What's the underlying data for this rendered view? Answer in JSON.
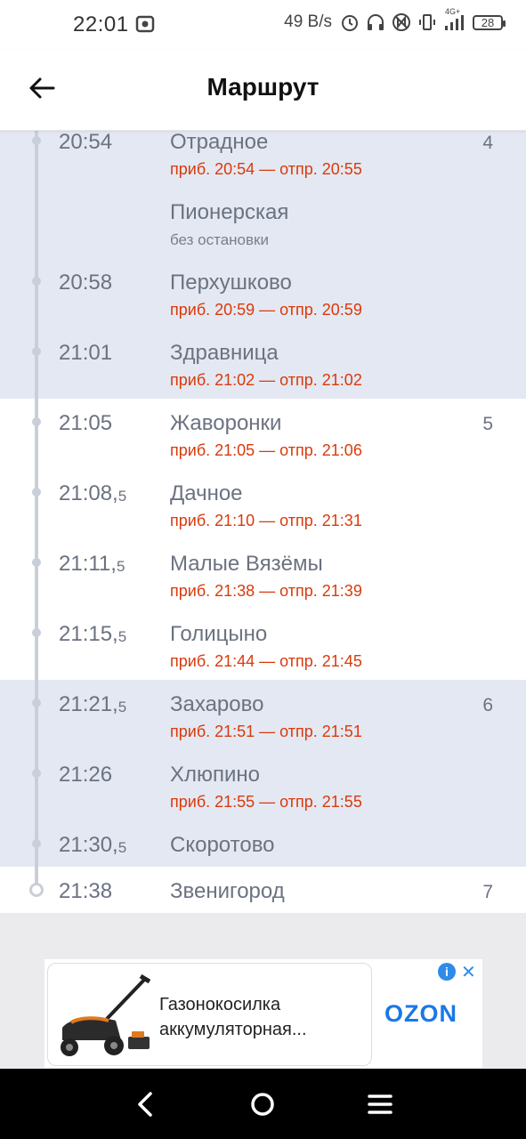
{
  "status_bar": {
    "time": "22:01",
    "speed": "49 B/s",
    "network": "4G+",
    "battery": "28",
    "icons": [
      "cast-icon",
      "alarm-icon",
      "headphones-icon",
      "nfc-icon",
      "vibrate-icon",
      "signal-icon",
      "battery-icon"
    ]
  },
  "header": {
    "title": "Маршрут",
    "back_icon": "back-arrow-icon"
  },
  "stops": [
    {
      "time": "20:54",
      "time_sub": "",
      "name": "Отрадное",
      "detail": "приб. 20:54 — отпр. 20:55",
      "detail_type": "red",
      "zone": "4"
    },
    {
      "time": "",
      "time_sub": "",
      "name": "Пионерская",
      "detail": "без остановки",
      "detail_type": "gray",
      "zone": ""
    },
    {
      "time": "20:58",
      "time_sub": "",
      "name": "Перхушково",
      "detail": "приб. 20:59 — отпр. 20:59",
      "detail_type": "red",
      "zone": ""
    },
    {
      "time": "21:01",
      "time_sub": "",
      "name": "Здравница",
      "detail": "приб. 21:02 — отпр. 21:02",
      "detail_type": "red",
      "zone": ""
    },
    {
      "time": "21:05",
      "time_sub": "",
      "name": "Жаворонки",
      "detail": "приб. 21:05 — отпр. 21:06",
      "detail_type": "red",
      "zone": "5"
    },
    {
      "time": "21:08,",
      "time_sub": "5",
      "name": "Дачное",
      "detail": "приб. 21:10 — отпр. 21:31",
      "detail_type": "red",
      "zone": ""
    },
    {
      "time": "21:11,",
      "time_sub": "5",
      "name": "Малые Вязёмы",
      "detail": "приб. 21:38 — отпр. 21:39",
      "detail_type": "red",
      "zone": ""
    },
    {
      "time": "21:15,",
      "time_sub": "5",
      "name": "Голицыно",
      "detail": "приб. 21:44 — отпр. 21:45",
      "detail_type": "red",
      "zone": ""
    },
    {
      "time": "21:21,",
      "time_sub": "5",
      "name": "Захарово",
      "detail": "приб. 21:51 — отпр. 21:51",
      "detail_type": "red",
      "zone": "6"
    },
    {
      "time": "21:26",
      "time_sub": "",
      "name": "Хлюпино",
      "detail": "приб. 21:55 — отпр. 21:55",
      "detail_type": "red",
      "zone": ""
    },
    {
      "time": "21:30,",
      "time_sub": "5",
      "name": "Скоротово",
      "detail": "",
      "detail_type": "",
      "zone": ""
    },
    {
      "time": "21:38",
      "time_sub": "",
      "name": "Звенигород",
      "detail": "",
      "detail_type": "",
      "zone": "7"
    }
  ],
  "ad": {
    "text": "Газонокосилка аккумуляторная...",
    "brand": "OZON",
    "info_icon": "info-icon",
    "close_icon": "close-icon"
  },
  "nav_bar": {
    "icons": [
      "back-icon",
      "home-icon",
      "menu-icon"
    ]
  },
  "colors": {
    "accent_red": "#d93a0b",
    "zone_shade": "#e4e8f2",
    "timeline": "#c8cfda",
    "ozon_blue": "#1a78e6"
  }
}
